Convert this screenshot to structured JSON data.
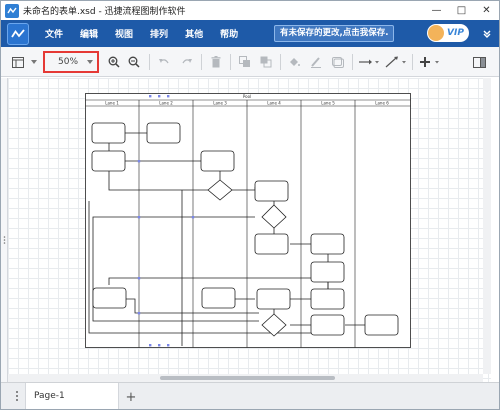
{
  "window": {
    "title": "未命名的表单.xsd - 迅捷流程图制作软件",
    "minimize_label": "—",
    "maximize_label": "□",
    "close_label": "✕"
  },
  "menu": {
    "items": [
      {
        "label": "文件"
      },
      {
        "label": "编辑"
      },
      {
        "label": "视图"
      },
      {
        "label": "排列"
      },
      {
        "label": "其他"
      },
      {
        "label": "帮助"
      }
    ],
    "save_notice": "有未保存的更改,点击我保存.",
    "vip_label": "VIP"
  },
  "toolbar": {
    "zoom_value": "50%",
    "icons": [
      "format-panel-icon",
      "zoom-in-icon",
      "zoom-out-icon",
      "undo-icon",
      "redo-icon",
      "delete-icon",
      "to-front-icon",
      "to-back-icon",
      "fill-color-icon",
      "line-color-icon",
      "shadow-icon",
      "connection-icon",
      "waypoint-icon",
      "insert-icon",
      "fullscreen-icon"
    ]
  },
  "diagram": {
    "pool_title": "Pool",
    "lanes": [
      {
        "label": "Lane 1"
      },
      {
        "label": "Lane 2"
      },
      {
        "label": "Lane 3"
      },
      {
        "label": "Lane 4"
      },
      {
        "label": "Lane 5"
      },
      {
        "label": "Lane 6"
      }
    ]
  },
  "pages": {
    "tabs": [
      {
        "label": "Page-1"
      }
    ],
    "add_label": "+"
  },
  "colors": {
    "menubar": "#1e5aa8",
    "highlight": "#e53935",
    "canvas_grid": "#e8ebee"
  }
}
